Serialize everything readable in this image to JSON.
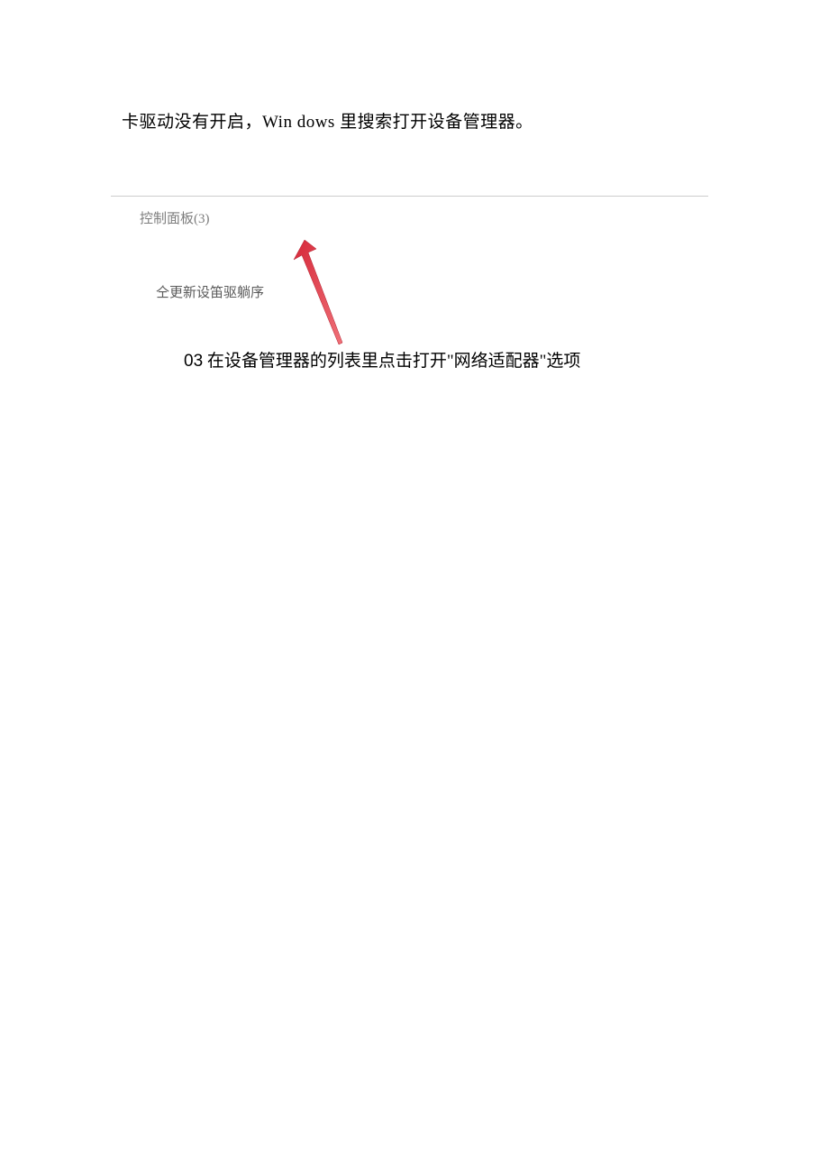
{
  "intro": "卡驱动没有开启，Win dows 里搜索打开设备管理器。",
  "panel_label": "控制面板(3)",
  "update_label": "仝更新设笛驱躺序",
  "step_num": "03",
  "step_text": " 在设备管理器的列表里点击打开\"网络适配器\"选项",
  "arrow_color": "#e63946"
}
